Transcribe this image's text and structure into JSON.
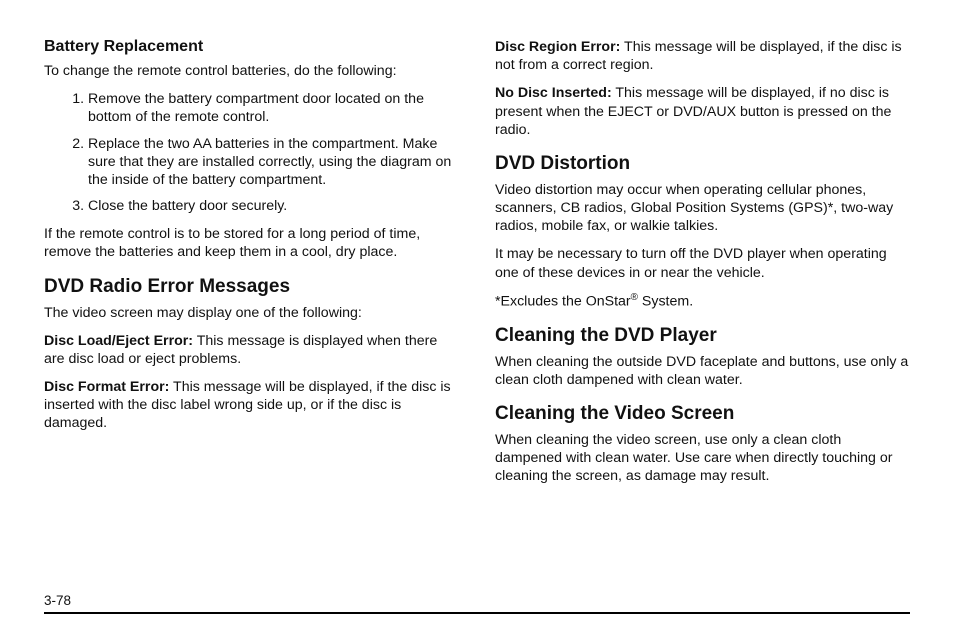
{
  "left": {
    "battery": {
      "heading": "Battery Replacement",
      "intro": "To change the remote control batteries, do the following:",
      "steps": [
        "Remove the battery compartment door located on the bottom of the remote control.",
        "Replace the two AA batteries in the compartment. Make sure that they are installed correctly, using the diagram on the inside of the battery compartment.",
        "Close the battery door securely."
      ],
      "outro": "If the remote control is to be stored for a long period of time, remove the batteries and keep them in a cool, dry place."
    },
    "errors": {
      "heading": "DVD Radio Error Messages",
      "intro": "The video screen may display one of the following:",
      "items": [
        {
          "lead": "Disc Load/Eject Error:",
          "text": "  This message is displayed when there are disc load or eject problems."
        },
        {
          "lead": "Disc Format Error:",
          "text": "  This message will be displayed, if the disc is inserted with the disc label wrong side up, or if the disc is damaged."
        }
      ]
    }
  },
  "right": {
    "errors_continued": [
      {
        "lead": "Disc Region Error:",
        "text": "  This message will be displayed, if the disc is not from a correct region."
      },
      {
        "lead": "No Disc Inserted:",
        "text": "  This message will be displayed, if no disc is present when the EJECT or DVD/AUX button is pressed on the radio."
      }
    ],
    "distortion": {
      "heading": "DVD Distortion",
      "paras": [
        "Video distortion may occur when operating cellular phones, scanners, CB radios, Global Position Systems (GPS)*, two-way radios, mobile fax, or walkie talkies.",
        "It may be necessary to turn off the DVD player when operating one of these devices in or near the vehicle."
      ],
      "note_prefix": "*Excludes the OnStar",
      "note_suffix": " System."
    },
    "clean_player": {
      "heading": "Cleaning the DVD Player",
      "text": "When cleaning the outside DVD faceplate and buttons, use only a clean cloth dampened with clean water."
    },
    "clean_screen": {
      "heading": "Cleaning the Video Screen",
      "text": "When cleaning the video screen, use only a clean cloth dampened with clean water. Use care when directly touching or cleaning the screen, as damage may result."
    }
  },
  "page_number": "3-78"
}
